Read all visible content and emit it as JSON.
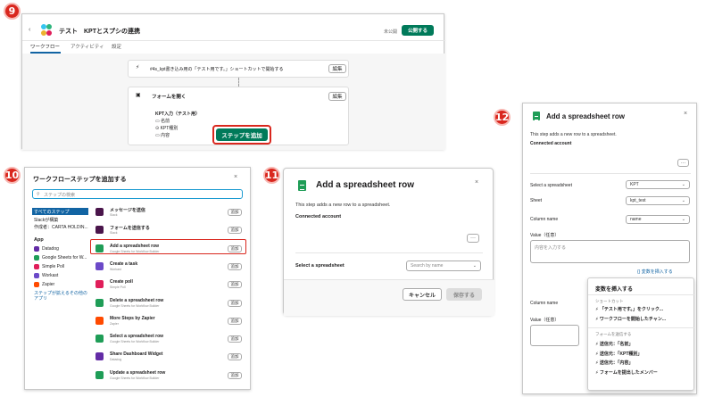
{
  "badges": {
    "b9": "9",
    "b10": "10",
    "b11": "11",
    "b12": "12"
  },
  "p9": {
    "title": "テスト　KPTとスプシの連携",
    "tabs": [
      "ワークフロー",
      "アクティビティ",
      "設定"
    ],
    "status": "未公開",
    "publish": "公開する",
    "step1": "#4s_kpt書き込み用の「テスト用です。」ショートカットで開始する",
    "edit": "編集",
    "step2": "フォームを開く",
    "form_title": "KPT入力（テスト用）",
    "fields": [
      "名前",
      "KPT種別",
      "内容"
    ],
    "add_step": "ステップを追加"
  },
  "p10": {
    "title": "ワークフローステップを追加する",
    "search_placeholder": "ステップの検索",
    "cats": [
      "すべてのステップ",
      "Slackが構築",
      "作成者：CARTA HOLDIN..."
    ],
    "app_label": "App",
    "apps": [
      "Datadog",
      "Google Sheets for W...",
      "Simple Poll",
      "Workast",
      "Zapier"
    ],
    "link": "ステップが拡えるその他のアプリ",
    "add": "追加",
    "steps": [
      {
        "name": "メッセージを送信",
        "sub": "Slack",
        "color": "#4a154b"
      },
      {
        "name": "フォームを送信する",
        "sub": "Slack",
        "color": "#4a154b"
      },
      {
        "name": "Add a spreadsheet row",
        "sub": "Google Sheets for Workflow Builder",
        "color": "#1f9d57"
      },
      {
        "name": "Create a task",
        "sub": "Workast",
        "color": "#6b49c8"
      },
      {
        "name": "Create poll",
        "sub": "Simple Poll",
        "color": "#e01e5a"
      },
      {
        "name": "Delete a spreadsheet row",
        "sub": "Google Sheets for Workflow Builder",
        "color": "#1f9d57"
      },
      {
        "name": "More Steps by Zapier",
        "sub": "Zapier",
        "color": "#ff4a00"
      },
      {
        "name": "Select a spreadsheet row",
        "sub": "Google Sheets for Workflow Builder",
        "color": "#1f9d57"
      },
      {
        "name": "Share Dashboard Widget",
        "sub": "Datadog",
        "color": "#632ca6"
      },
      {
        "name": "Update a spreadsheet row",
        "sub": "Google Sheets for Workflow Builder",
        "color": "#1f9d57"
      }
    ]
  },
  "p11": {
    "title": "Add a spreadsheet row",
    "desc": "This step adds a new row to a spreadsheet.",
    "connected": "Connected account",
    "select_label": "Select a spreadsheet",
    "search_placeholder": "Search by name",
    "cancel": "キャンセル",
    "save": "保存する"
  },
  "p12": {
    "title": "Add a spreadsheet row",
    "desc": "This step adds a new row to a spreadsheet.",
    "connected": "Connected account",
    "select_label": "Select a spreadsheet",
    "select_value": "KPT",
    "sheet_label": "Sheet",
    "sheet_value": "kpt_test",
    "col_label": "Column name",
    "col_value": "name",
    "val_label": "Value（任意）",
    "val_placeholder": "内容を入力する",
    "insert_var": "変数を挿入する",
    "col_label2": "Column name",
    "val_label2": "Value（任意）",
    "menu_title": "変数を挿入する",
    "menu_sec1": "ショートカット",
    "menu_items1": [
      "「テスト用です。」をクリック...",
      "ワークフローを開始したチャン..."
    ],
    "menu_sec2": "フォームを送信する",
    "menu_items2": [
      "送信元：「名前」",
      "送信元：「KPT種別」",
      "送信元：「内容」",
      "フォームを提出したメンバー"
    ]
  }
}
